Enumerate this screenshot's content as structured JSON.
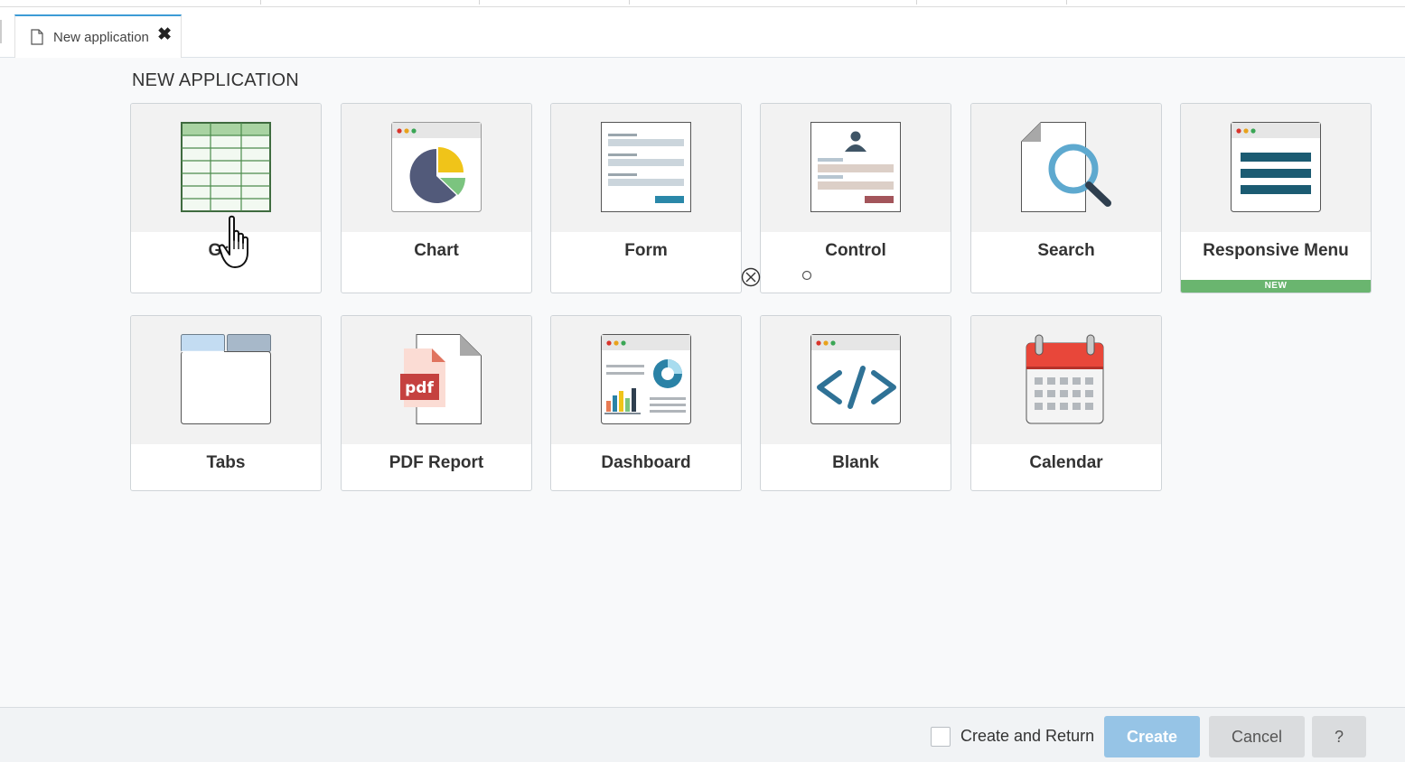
{
  "tab": {
    "label": "New application",
    "icon": "document-icon",
    "close_icon": "✖"
  },
  "page": {
    "title": "NEW APPLICATION"
  },
  "cards": [
    {
      "id": "grid",
      "label": "Grid",
      "icon": "grid-table-icon"
    },
    {
      "id": "chart",
      "label": "Chart",
      "icon": "pie-chart-icon"
    },
    {
      "id": "form",
      "label": "Form",
      "icon": "form-icon"
    },
    {
      "id": "control",
      "label": "Control",
      "icon": "control-icon"
    },
    {
      "id": "search",
      "label": "Search",
      "icon": "search-icon"
    },
    {
      "id": "responsive-menu",
      "label": "Responsive Menu",
      "icon": "menu-icon",
      "badge": "NEW"
    },
    {
      "id": "tabs",
      "label": "Tabs",
      "icon": "tabs-icon"
    },
    {
      "id": "pdf-report",
      "label": "PDF Report",
      "icon": "pdf-icon"
    },
    {
      "id": "dashboard",
      "label": "Dashboard",
      "icon": "dashboard-icon"
    },
    {
      "id": "blank",
      "label": "Blank",
      "icon": "code-icon"
    },
    {
      "id": "calendar",
      "label": "Calendar",
      "icon": "calendar-icon"
    }
  ],
  "footer": {
    "create_and_return_label": "Create and Return",
    "create_and_return_checked": false,
    "create_label": "Create",
    "cancel_label": "Cancel",
    "help_label": "?"
  },
  "colors": {
    "accent": "#3c9bd6",
    "create_button": "#96c4e6",
    "badge_green": "#6ab56f"
  }
}
